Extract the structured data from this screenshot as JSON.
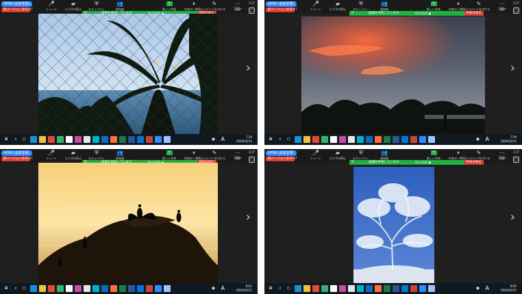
{
  "meta": {
    "layout": "2x2 grid of video-conference screen-share screenshots"
  },
  "panels": [
    {
      "id": "palm-fence",
      "app_badge": "HP99 (名前変更)",
      "version_badge": "新バージョンあり",
      "exit_label": "EXIT",
      "toolbar": [
        {
          "icon": "microphone-icon",
          "glyph": "🎤",
          "label": "ミュート"
        },
        {
          "icon": "video-camera-icon",
          "glyph": "▰",
          "label": "ビデオの停止"
        },
        {
          "icon": "security-shield-icon",
          "glyph": "⛨",
          "label": "セキュリティ"
        },
        {
          "icon": "participants-icon",
          "glyph": "👥",
          "label": "参加者"
        },
        {
          "icon": "new-share-icon",
          "glyph": "↑",
          "label": "新しい共有"
        },
        {
          "icon": "pause-share-icon",
          "glyph": "⏸",
          "label": "共有の一時停止"
        },
        {
          "icon": "annotate-icon",
          "glyph": "✎",
          "label": "コメントを付ける"
        },
        {
          "icon": "more-icon",
          "glyph": "⋯",
          "label": "詳細"
        }
      ],
      "share_bar": {
        "message": "画面を共有しています",
        "status": "ID:12345  ●",
        "stop_label": "共有の停止"
      },
      "right_labels": [
        "コピー",
        "ログ"
      ],
      "clock": {
        "time": "7:19",
        "date": "2020/10/11"
      }
    },
    {
      "id": "sunset-sky",
      "app_badge": "HP99 (名前変更)",
      "version_badge": "新バージョンあり",
      "exit_label": "EXIT",
      "toolbar": [
        {
          "icon": "microphone-icon",
          "glyph": "🎤",
          "label": "ミュート"
        },
        {
          "icon": "video-camera-icon",
          "glyph": "▰",
          "label": "ビデオの停止"
        },
        {
          "icon": "security-shield-icon",
          "glyph": "⛨",
          "label": "セキュリティ"
        },
        {
          "icon": "participants-icon",
          "glyph": "👥",
          "label": "参加者"
        },
        {
          "icon": "new-share-icon",
          "glyph": "↑",
          "label": "新しい共有"
        },
        {
          "icon": "pause-share-icon",
          "glyph": "⏸",
          "label": "共有の一時停止"
        },
        {
          "icon": "annotate-icon",
          "glyph": "✎",
          "label": "コメントを付ける"
        },
        {
          "icon": "more-icon",
          "glyph": "⋯",
          "label": "詳細"
        }
      ],
      "share_bar": {
        "message": "画面を共有しています",
        "status": "ID:12345  ●",
        "stop_label": "共有の停止"
      },
      "right_labels": [
        "コピー",
        "ログ"
      ],
      "clock": {
        "time": "7:59",
        "date": "2020/10/11"
      }
    },
    {
      "id": "cormorant-rock",
      "app_badge": "HP99 (名前変更)",
      "version_badge": "新バージョンあり",
      "exit_label": "EXIT",
      "toolbar": [
        {
          "icon": "microphone-icon",
          "glyph": "🎤",
          "label": "ミュート"
        },
        {
          "icon": "video-camera-icon",
          "glyph": "▰",
          "label": "ビデオの停止"
        },
        {
          "icon": "security-shield-icon",
          "glyph": "⛨",
          "label": "セキュリティ"
        },
        {
          "icon": "participants-icon",
          "glyph": "👥",
          "label": "参加者"
        },
        {
          "icon": "new-share-icon",
          "glyph": "↑",
          "label": "新しい共有"
        },
        {
          "icon": "pause-share-icon",
          "glyph": "⏸",
          "label": "共有の一時停止"
        },
        {
          "icon": "annotate-icon",
          "glyph": "✎",
          "label": "コメントを付ける"
        },
        {
          "icon": "more-icon",
          "glyph": "⋯",
          "label": "詳細"
        }
      ],
      "share_bar": {
        "message": "画面を共有しています",
        "status": "ID:12345  ●",
        "stop_label": "共有の停止"
      },
      "right_labels": [
        "コピー",
        "ログ"
      ],
      "clock": {
        "time": "8:01",
        "date": "2020/10/11"
      }
    },
    {
      "id": "snow-tree",
      "app_badge": "HP99 (名前変更)",
      "version_badge": "新バージョンあり",
      "exit_label": "EXIT",
      "toolbar": [
        {
          "icon": "microphone-icon",
          "glyph": "🎤",
          "label": "ミュート"
        },
        {
          "icon": "video-camera-icon",
          "glyph": "▰",
          "label": "ビデオの停止"
        },
        {
          "icon": "security-shield-icon",
          "glyph": "⛨",
          "label": "セキュリティ"
        },
        {
          "icon": "participants-icon",
          "glyph": "👥",
          "label": "参加者"
        },
        {
          "icon": "new-share-icon",
          "glyph": "↑",
          "label": "新しい共有"
        },
        {
          "icon": "pause-share-icon",
          "glyph": "⏸",
          "label": "共有の一時停止"
        },
        {
          "icon": "annotate-icon",
          "glyph": "✎",
          "label": "コメントを付ける"
        },
        {
          "icon": "more-icon",
          "glyph": "⋯",
          "label": "詳細"
        }
      ],
      "share_bar": {
        "message": "画面を共有しています",
        "status": "ID:12345  ●",
        "stop_label": "共有の停止"
      },
      "right_labels": [
        "コピー",
        "ログ"
      ],
      "clock": {
        "time": "8:02",
        "date": "2020/10/11"
      }
    }
  ],
  "taskbar_apps": [
    {
      "icon": "edge-browser-icon",
      "color": "#1a8fd9"
    },
    {
      "icon": "file-explorer-icon",
      "color": "#f2c13c"
    },
    {
      "icon": "chrome-icon",
      "color": "#e24b35"
    },
    {
      "icon": "edge-icon",
      "color": "#35b56b"
    },
    {
      "icon": "pen-app-icon",
      "color": "#ffffff"
    },
    {
      "icon": "paint-app-icon",
      "color": "#c94da0"
    },
    {
      "icon": "notepad-icon",
      "color": "#e7e7e7"
    },
    {
      "icon": "terminal-icon",
      "color": "#00b4c8"
    },
    {
      "icon": "outlook-icon",
      "color": "#0f6cbd"
    },
    {
      "icon": "firefox-icon",
      "color": "#ff7139"
    },
    {
      "icon": "excel-icon",
      "color": "#1d7a45"
    },
    {
      "icon": "word-icon",
      "color": "#2b5797"
    },
    {
      "icon": "mail-icon",
      "color": "#0078d4"
    },
    {
      "icon": "powerpoint-icon",
      "color": "#c74634"
    },
    {
      "icon": "zoom-icon",
      "color": "#2d8cff"
    },
    {
      "icon": "photos-icon",
      "color": "#9cc4ff"
    }
  ],
  "colors": {
    "zoom_blue": "#2d8cff",
    "share_green": "#1fb141",
    "stop_red": "#e03c31",
    "toolbar_bg": "#1a1a1a",
    "taskbar_bg": "#101820"
  }
}
